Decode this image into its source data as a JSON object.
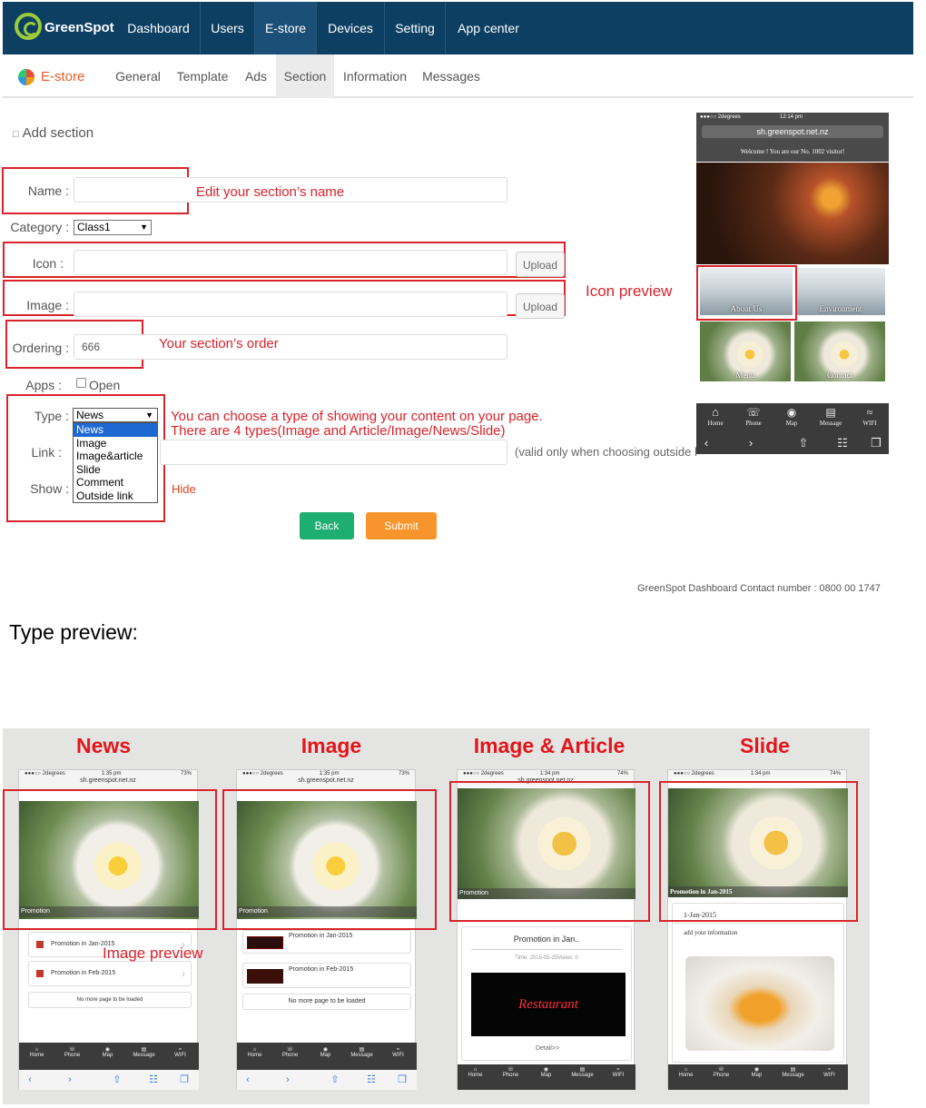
{
  "app": {
    "brand": "GreenSpot"
  },
  "nav": {
    "items": [
      "Dashboard",
      "Users",
      "E-store",
      "Devices",
      "Setting",
      "App center"
    ],
    "active": "E-store"
  },
  "subnav": {
    "title": "E-store",
    "items": [
      "General",
      "Template",
      "Ads",
      "Section",
      "Information",
      "Messages"
    ],
    "active": "Section"
  },
  "form": {
    "heading": "Add section",
    "name_label": "Name :",
    "category_label": "Category :",
    "category_value": "Class1",
    "icon_label": "Icon :",
    "image_label": "Image :",
    "upload_label": "Upload",
    "ordering_label": "Ordering :",
    "ordering_value": "666",
    "apps_label": "Apps :",
    "apps_open": "Open",
    "type_label": "Type :",
    "type_value": "News",
    "type_options": [
      "News",
      "Image",
      "Image&article",
      "Slide",
      "Comment",
      "Outside link"
    ],
    "link_label": "Link :",
    "link_hint": "(valid only when choosing outside link)",
    "show_label": "Show :",
    "hide_label": "Hide",
    "back": "Back",
    "submit": "Submit"
  },
  "annotations": {
    "name": "Edit your section’s name",
    "order": "Your section’s order",
    "type_line1": "You can choose a type of showing your content on your page.",
    "type_line2": "There are 4 types(Image and Article/Image/News/Slide)",
    "icon_preview": "Icon preview",
    "image_preview": "Image preview"
  },
  "footer": {
    "contact": "GreenSpot Dashboard Contact number : 0800 00 1747"
  },
  "preview_phone": {
    "carrier": "●●●○○ 2degrees",
    "time": "12:14 pm",
    "url": "sh.greenspot.net.nz",
    "welcome": "Welcome ! You are our No. 1002 visitor!",
    "tiles": [
      "About Us",
      "Environment",
      "Menu",
      "Contact"
    ],
    "tabs": [
      "Home",
      "Phone",
      "Map",
      "Message",
      "WIFI"
    ]
  },
  "type_preview": {
    "title": "Type preview:",
    "columns": [
      "News",
      "Image",
      "Image & Article",
      "Slide"
    ],
    "status": {
      "carrier": "●●●○○ 2degrees",
      "time_a": "1:35 pm",
      "time_b": "1:34 pm",
      "battery_a": "73%",
      "battery_b": "74%",
      "url": "sh.greenspot.net.nz"
    },
    "promotion": "Promotion",
    "promo_jan": "Promotion in Jan-2015",
    "promo_feb": "Promotion in Feb-2015",
    "no_more": "No more page to be loaded",
    "article_title": "Promotion in Jan..",
    "article_meta": "Time:  2015-05-25Views:  0",
    "article_detail": "Detail>>",
    "neon": "Restaurant",
    "slide_caption": "Promotion in Jan-2015",
    "slide_date": "1-Jan-2015",
    "slide_info": "add your information",
    "tabs": [
      "Home",
      "Phone",
      "Map",
      "Message",
      "WIFI"
    ]
  },
  "colors": {
    "topbar": "#0d3f63",
    "annotation": "#d9232a",
    "back": "#1fae72",
    "submit": "#f7952c",
    "brand_accent": "#9ccb3b"
  }
}
